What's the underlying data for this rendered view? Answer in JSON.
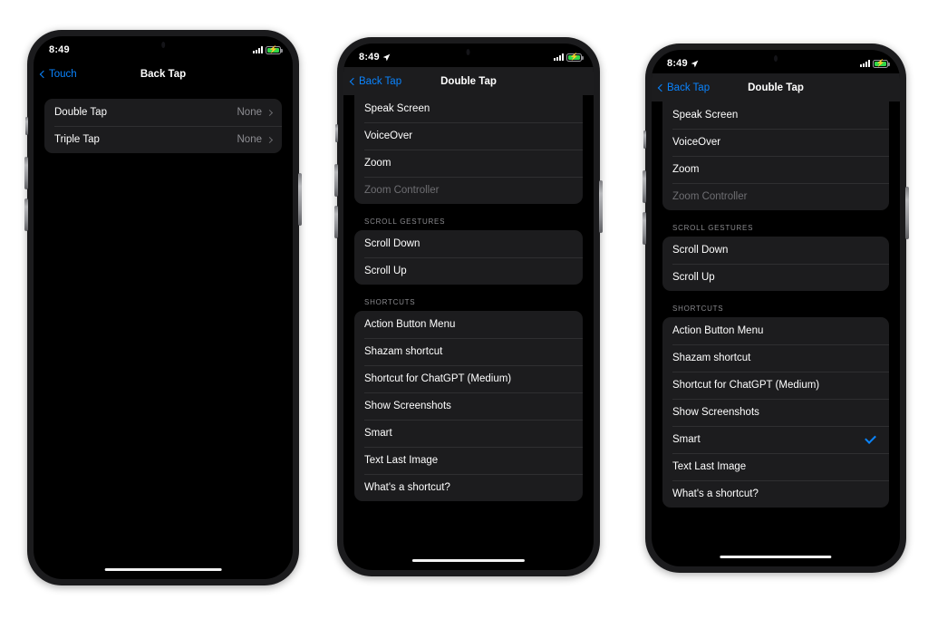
{
  "phones": [
    {
      "id": "phone-back-tap",
      "status": {
        "time": "8:49",
        "location_arrow": false,
        "battery_charging": true
      },
      "nav": {
        "back_label": "Touch",
        "title": "Back Tap"
      },
      "scrolled": false,
      "sections": [
        {
          "header": "",
          "rows": [
            {
              "label": "Double Tap",
              "value": "None",
              "chevron": true,
              "dim": false,
              "checked": false
            },
            {
              "label": "Triple Tap",
              "value": "None",
              "chevron": true,
              "dim": false,
              "checked": false
            }
          ]
        }
      ]
    },
    {
      "id": "phone-double-tap-list",
      "status": {
        "time": "8:49",
        "location_arrow": true,
        "battery_charging": true
      },
      "nav": {
        "back_label": "Back Tap",
        "title": "Double Tap"
      },
      "scrolled": true,
      "sections": [
        {
          "header": "",
          "rows": [
            {
              "label": "Speak Screen",
              "value": "",
              "chevron": false,
              "dim": false,
              "checked": false
            },
            {
              "label": "VoiceOver",
              "value": "",
              "chevron": false,
              "dim": false,
              "checked": false
            },
            {
              "label": "Zoom",
              "value": "",
              "chevron": false,
              "dim": false,
              "checked": false
            },
            {
              "label": "Zoom Controller",
              "value": "",
              "chevron": false,
              "dim": true,
              "checked": false
            }
          ]
        },
        {
          "header": "SCROLL GESTURES",
          "rows": [
            {
              "label": "Scroll Down",
              "value": "",
              "chevron": false,
              "dim": false,
              "checked": false
            },
            {
              "label": "Scroll Up",
              "value": "",
              "chevron": false,
              "dim": false,
              "checked": false
            }
          ]
        },
        {
          "header": "SHORTCUTS",
          "rows": [
            {
              "label": "Action Button Menu",
              "value": "",
              "chevron": false,
              "dim": false,
              "checked": false
            },
            {
              "label": "Shazam shortcut",
              "value": "",
              "chevron": false,
              "dim": false,
              "checked": false
            },
            {
              "label": "Shortcut for ChatGPT (Medium)",
              "value": "",
              "chevron": false,
              "dim": false,
              "checked": false
            },
            {
              "label": "Show Screenshots",
              "value": "",
              "chevron": false,
              "dim": false,
              "checked": false
            },
            {
              "label": "Smart",
              "value": "",
              "chevron": false,
              "dim": false,
              "checked": false
            },
            {
              "label": "Text Last Image",
              "value": "",
              "chevron": false,
              "dim": false,
              "checked": false
            },
            {
              "label": "What's a shortcut?",
              "value": "",
              "chevron": false,
              "dim": false,
              "checked": false
            }
          ]
        }
      ]
    },
    {
      "id": "phone-double-tap-selected",
      "status": {
        "time": "8:49",
        "location_arrow": true,
        "battery_charging": true
      },
      "nav": {
        "back_label": "Back Tap",
        "title": "Double Tap"
      },
      "scrolled": true,
      "sections": [
        {
          "header": "",
          "rows": [
            {
              "label": "Speak Screen",
              "value": "",
              "chevron": false,
              "dim": false,
              "checked": false
            },
            {
              "label": "VoiceOver",
              "value": "",
              "chevron": false,
              "dim": false,
              "checked": false
            },
            {
              "label": "Zoom",
              "value": "",
              "chevron": false,
              "dim": false,
              "checked": false
            },
            {
              "label": "Zoom Controller",
              "value": "",
              "chevron": false,
              "dim": true,
              "checked": false
            }
          ]
        },
        {
          "header": "SCROLL GESTURES",
          "rows": [
            {
              "label": "Scroll Down",
              "value": "",
              "chevron": false,
              "dim": false,
              "checked": false
            },
            {
              "label": "Scroll Up",
              "value": "",
              "chevron": false,
              "dim": false,
              "checked": false
            }
          ]
        },
        {
          "header": "SHORTCUTS",
          "rows": [
            {
              "label": "Action Button Menu",
              "value": "",
              "chevron": false,
              "dim": false,
              "checked": false
            },
            {
              "label": "Shazam shortcut",
              "value": "",
              "chevron": false,
              "dim": false,
              "checked": false
            },
            {
              "label": "Shortcut for ChatGPT (Medium)",
              "value": "",
              "chevron": false,
              "dim": false,
              "checked": false
            },
            {
              "label": "Show Screenshots",
              "value": "",
              "chevron": false,
              "dim": false,
              "checked": false
            },
            {
              "label": "Smart",
              "value": "",
              "chevron": false,
              "dim": false,
              "checked": true
            },
            {
              "label": "Text Last Image",
              "value": "",
              "chevron": false,
              "dim": false,
              "checked": false
            },
            {
              "label": "What's a shortcut?",
              "value": "",
              "chevron": false,
              "dim": false,
              "checked": false
            }
          ]
        }
      ]
    }
  ],
  "colors": {
    "accent": "#0a84ff",
    "page_background": "#ffffff",
    "screen_background": "#000000",
    "group_background": "#1c1c1e",
    "secondary_text": "#8e8e93",
    "battery_green": "#32d74b"
  },
  "icons": {
    "back_chevron": "chevron-left-icon",
    "row_chevron": "chevron-right-icon",
    "checkmark": "checkmark-icon",
    "location": "location-arrow-icon",
    "signal": "cellular-signal-icon",
    "battery": "battery-charging-icon"
  }
}
